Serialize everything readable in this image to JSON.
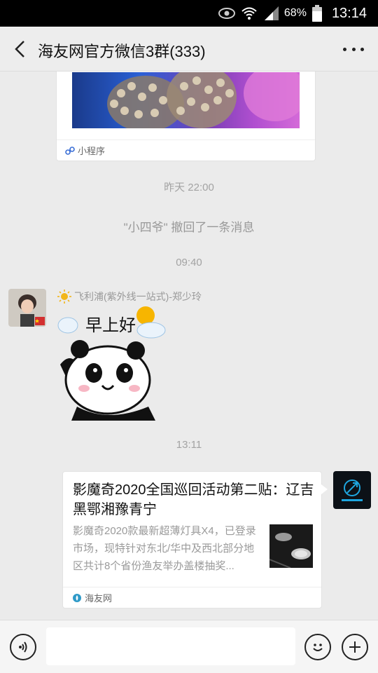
{
  "status_bar": {
    "battery": "68%",
    "time": "13:14"
  },
  "header": {
    "title": "海友网官方微信3群(333)"
  },
  "messages": {
    "mini_program_card": {
      "footer_label": "小程序"
    },
    "timestamp_1": "昨天 22:00",
    "recall_notice": "\"小四爷\" 撤回了一条消息",
    "timestamp_2": "09:40",
    "sticker_message": {
      "sender_name": "飞利浦(紫外线一站式)-郑少玲",
      "sticker_text": "早上好"
    },
    "timestamp_3": "13:11",
    "link_card": {
      "title": "影魔奇2020全国巡回活动第二贴：辽吉黑鄂湘豫青宁",
      "description": "影魔奇2020款最新超薄灯具X4，已登录市场，现特针对东北/华中及西北部分地区共计8个省份渔友举办盖楼抽奖...",
      "source": "海友网"
    }
  },
  "input_bar": {
    "placeholder": ""
  },
  "colors": {
    "header_bg": "#ededed",
    "chat_bg": "#ebebeb",
    "status_bar_bg": "#000000"
  }
}
